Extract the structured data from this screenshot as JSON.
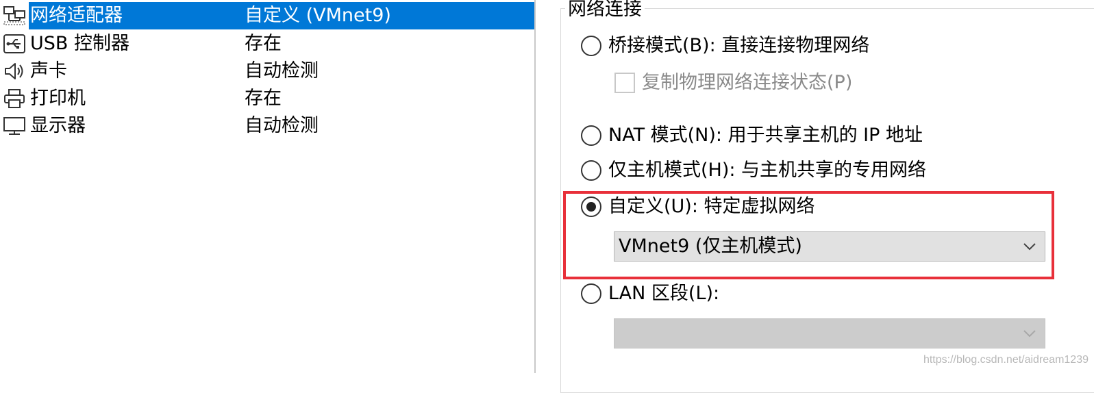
{
  "devices": [
    {
      "name": "网络适配器",
      "value": "自定义 (VMnet9)",
      "icon": "network-adapter-icon",
      "selected": true
    },
    {
      "name": "USB 控制器",
      "value": "存在",
      "icon": "usb-icon",
      "selected": false
    },
    {
      "name": "声卡",
      "value": "自动检测",
      "icon": "speaker-icon",
      "selected": false
    },
    {
      "name": "打印机",
      "value": "存在",
      "icon": "printer-icon",
      "selected": false
    },
    {
      "name": "显示器",
      "value": "自动检测",
      "icon": "monitor-icon",
      "selected": false
    }
  ],
  "network": {
    "group_title": "网络连接",
    "bridged": {
      "label": "桥接模式(B): 直接连接物理网络",
      "checked": false
    },
    "replicate": {
      "label": "复制物理网络连接状态(P)",
      "checked": false,
      "enabled": false
    },
    "nat": {
      "label": "NAT 模式(N): 用于共享主机的 IP 地址",
      "checked": false
    },
    "host_only": {
      "label": "仅主机模式(H): 与主机共享的专用网络",
      "checked": false
    },
    "custom": {
      "label": "自定义(U): 特定虚拟网络",
      "checked": true,
      "selected_network": "VMnet9 (仅主机模式)"
    },
    "lan": {
      "label": "LAN 区段(L):",
      "checked": false,
      "selected_segment": ""
    }
  },
  "colors": {
    "selection": "#0078d7",
    "highlight_box": "#e8303a"
  },
  "watermark": "https://blog.csdn.net/aidream1239"
}
